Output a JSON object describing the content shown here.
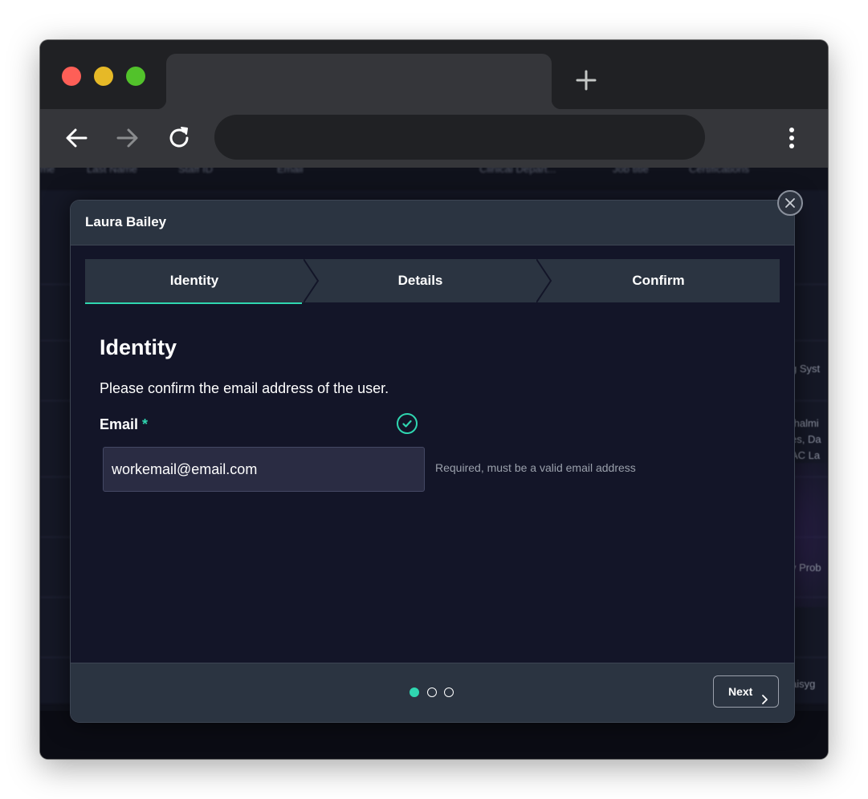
{
  "browser": {
    "traffic_lights": [
      "#fe5f57",
      "#e6b927",
      "#52c22b"
    ],
    "tab_title": "",
    "new_tab_icon": "plus-icon",
    "address": "",
    "nav_icons": [
      "back-arrow-icon",
      "forward-arrow-icon",
      "reload-icon",
      "more-vertical-icon"
    ]
  },
  "background_page": {
    "columns": [
      "me",
      "Last Name",
      "Staff ID",
      "Email",
      "Clinical Depart...",
      "Job title",
      "Certifications"
    ],
    "right_fragments": [
      "g Syst",
      "thalmi",
      "es, Da",
      "AC La",
      "y Prob",
      "aisyg"
    ]
  },
  "modal": {
    "title": "Laura Bailey",
    "close_icon": "close-icon",
    "steps": [
      {
        "label": "Identity",
        "active": true
      },
      {
        "label": "Details",
        "active": false
      },
      {
        "label": "Confirm",
        "active": false
      }
    ],
    "section_title": "Identity",
    "instructions": "Please confirm the email address of the user.",
    "email_label": "Email",
    "required_marker": "*",
    "email_value": "workemail@email.com",
    "helper_text": "Required, must be a valid email address",
    "valid_icon": "check-circle-icon",
    "pagination": {
      "current": 1,
      "total": 3
    },
    "next_label": "Next",
    "accent_color": "#2fd6b0"
  }
}
